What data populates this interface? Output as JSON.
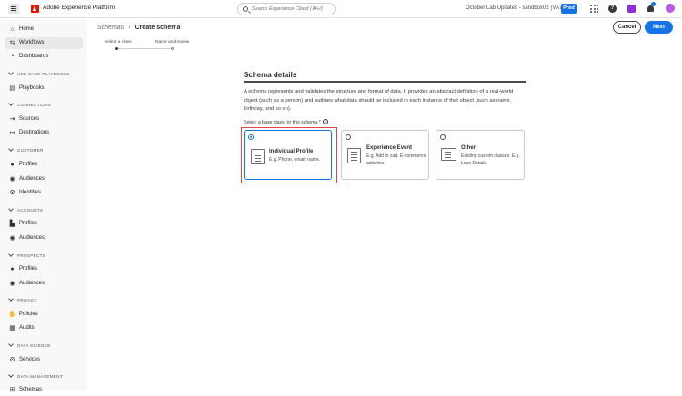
{
  "app": {
    "title": "Adobe Experience Platform"
  },
  "search": {
    "placeholder": "Search Experience Cloud (⌘+/)"
  },
  "org": {
    "name": "October Lab Updates - sandbox02 (VA7)",
    "env": "Prod"
  },
  "sidebar": {
    "items": [
      {
        "label": "Home",
        "icon": "home-icon"
      },
      {
        "label": "Workflows",
        "icon": "workflows-icon",
        "selected": true
      },
      {
        "label": "Dashboards",
        "icon": "dashboards-icon"
      }
    ],
    "sections": [
      {
        "title": "USE CASE PLAYBOOKS",
        "items": [
          {
            "label": "Playbooks",
            "icon": "playbooks-icon"
          }
        ]
      },
      {
        "title": "CONNECTIONS",
        "items": [
          {
            "label": "Sources",
            "icon": "sources-icon"
          },
          {
            "label": "Destinations",
            "icon": "destinations-icon"
          }
        ]
      },
      {
        "title": "CUSTOMER",
        "items": [
          {
            "label": "Profiles",
            "icon": "profiles-icon"
          },
          {
            "label": "Audiences",
            "icon": "audiences-icon"
          },
          {
            "label": "Identities",
            "icon": "identities-icon"
          }
        ]
      },
      {
        "title": "ACCOUNTS",
        "items": [
          {
            "label": "Profiles",
            "icon": "accounts-profiles-icon"
          },
          {
            "label": "Audiences",
            "icon": "audiences-icon"
          }
        ]
      },
      {
        "title": "PROSPECTS",
        "items": [
          {
            "label": "Profiles",
            "icon": "profiles-icon"
          },
          {
            "label": "Audiences",
            "icon": "audiences-icon"
          }
        ]
      },
      {
        "title": "PRIVACY",
        "items": [
          {
            "label": "Policies",
            "icon": "policies-icon"
          },
          {
            "label": "Audits",
            "icon": "audits-icon"
          }
        ]
      },
      {
        "title": "DATA SCIENCE",
        "items": [
          {
            "label": "Services",
            "icon": "services-icon"
          }
        ]
      },
      {
        "title": "DATA MANAGEMENT",
        "items": [
          {
            "label": "Schemas",
            "icon": "schemas-icon"
          }
        ]
      }
    ]
  },
  "breadcrumb": {
    "parent": "Schemas",
    "current": "Create schema"
  },
  "actions": {
    "cancel": "Cancel",
    "next": "Next"
  },
  "steps": [
    {
      "label": "Select a class",
      "active": true
    },
    {
      "label": "Name and review",
      "active": false
    }
  ],
  "details": {
    "heading": "Schema details",
    "description": "A schema represents and validates the structure and format of data. It provides an abstract definition of a real-world object (such as a person) and outlines what data should be included in each instance of that object (such as name, birthday, and so on).",
    "prompt": "Select a base class for this schema",
    "required_marker": "*"
  },
  "classes": [
    {
      "title": "Individual Profile",
      "description": "E.g. Phone, email, name.",
      "selected": true,
      "icon": "profile-card-icon"
    },
    {
      "title": "Experience Event",
      "description": "E.g. Add to cart, E-commerce activities.",
      "selected": false,
      "icon": "event-card-icon"
    },
    {
      "title": "Other",
      "description": "Existing custom classes. E.g. Loan Details.",
      "selected": false,
      "icon": "other-class-icon"
    }
  ],
  "colors": {
    "accent": "#1473e6",
    "brand": "#eb1000",
    "highlight": "#e34850"
  }
}
